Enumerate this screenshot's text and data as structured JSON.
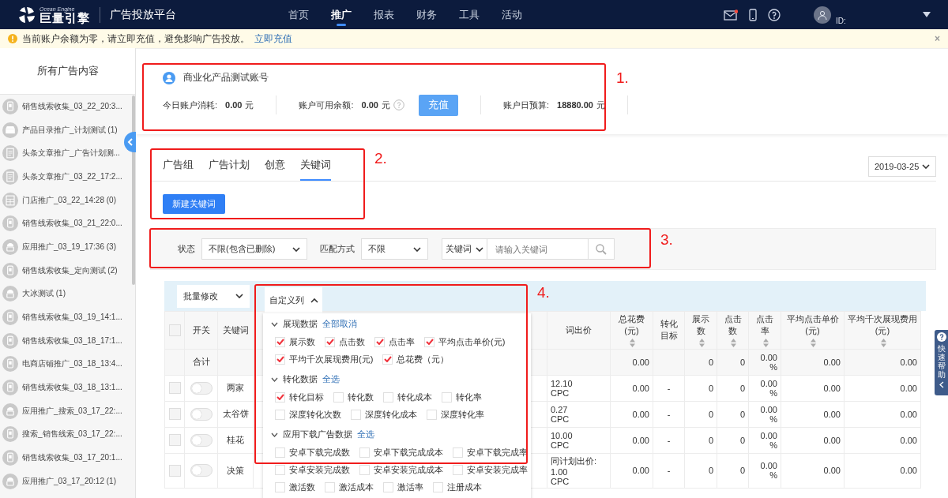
{
  "header": {
    "logo_sub": "Ocean Engine",
    "logo_text": "巨量引擎",
    "platform": "广告投放平台",
    "user_id_label": "ID:",
    "nav": [
      {
        "label": "首页",
        "selected": false
      },
      {
        "label": "推广",
        "selected": true
      },
      {
        "label": "报表",
        "selected": false
      },
      {
        "label": "财务",
        "selected": false
      },
      {
        "label": "工具",
        "selected": false
      },
      {
        "label": "活动",
        "selected": false
      }
    ]
  },
  "notice": {
    "text": "当前账户余额为零，请立即充值，避免影响广告投放。",
    "link": "立即充值",
    "close": "×"
  },
  "sidebar": {
    "title": "所有广告内容",
    "items": [
      {
        "label": "销售线索收集_03_22_20:3...",
        "kind": "phone"
      },
      {
        "label": "产品目录推广_计划测试 (1)",
        "kind": "shop"
      },
      {
        "label": "头条文章推广_广告计划测...",
        "kind": "doc"
      },
      {
        "label": "头条文章推广_03_22_17:2...",
        "kind": "doc"
      },
      {
        "label": "门店推广_03_22_14:28 (0)",
        "kind": "store"
      },
      {
        "label": "销售线索收集_03_21_22:0...",
        "kind": "phone"
      },
      {
        "label": "应用推广_03_19_17:36 (3)",
        "kind": "app"
      },
      {
        "label": "销售线索收集_定向测试 (2)",
        "kind": "phone"
      },
      {
        "label": "大冰测试 (1)",
        "kind": "app"
      },
      {
        "label": "销售线索收集_03_19_14:1...",
        "kind": "phone"
      },
      {
        "label": "销售线索收集_03_18_17:1...",
        "kind": "phone"
      },
      {
        "label": "电商店铺推广_03_18_13:4...",
        "kind": "phone"
      },
      {
        "label": "销售线索收集_03_18_13:1...",
        "kind": "phone"
      },
      {
        "label": "应用推广_搜索_03_17_22:...",
        "kind": "app"
      },
      {
        "label": "搜索_销售线索_03_17_22:...",
        "kind": "phone"
      },
      {
        "label": "销售线索收集_03_17_20:1...",
        "kind": "phone"
      },
      {
        "label": "应用推广_03_17_20:12 (1)",
        "kind": "app"
      }
    ]
  },
  "account": {
    "name": "商业化产品测试账号",
    "recharge": "充值",
    "stats": [
      {
        "label": "今日账户消耗:",
        "value": "0.00",
        "unit": "元",
        "help": false
      },
      {
        "label": "账户可用余额:",
        "value": "0.00",
        "unit": "元",
        "help": true
      },
      {
        "label": "账户日预算:",
        "value": "18880.00",
        "unit": "元",
        "help": false
      }
    ]
  },
  "tabs": [
    {
      "label": "广告组",
      "selected": false
    },
    {
      "label": "广告计划",
      "selected": false
    },
    {
      "label": "创意",
      "selected": false
    },
    {
      "label": "关键词",
      "selected": true
    }
  ],
  "new_button": "新建关键词",
  "date": "2019-03-25",
  "filters": {
    "status_label": "状态",
    "status_value": "不限(包含已删除)",
    "match_label": "匹配方式",
    "match_value": "不限",
    "search_scope": "关键词",
    "search_placeholder": "请输入关键词"
  },
  "toolbar": {
    "batch": "批量修改",
    "custom_columns": "自定义列",
    "custom_expanded": true
  },
  "table": {
    "select_all_checked": false,
    "columns": [
      {
        "label": "开关",
        "sortable": false
      },
      {
        "label": "关键词",
        "sortable": false
      },
      {
        "label": "词出价",
        "sortable": false
      },
      {
        "label": "总花费(元)",
        "sortable": true
      },
      {
        "label": "转化目标",
        "sortable": false
      },
      {
        "label": "展示数",
        "sortable": true
      },
      {
        "label": "点击数",
        "sortable": true
      },
      {
        "label": "点击率",
        "sortable": true
      },
      {
        "label": "平均点击单价(元)",
        "sortable": true
      },
      {
        "label": "平均千次展现费用(元)",
        "sortable": true
      }
    ],
    "total": {
      "checked": false,
      "cells": [
        "合计",
        null,
        null,
        "0.00",
        null,
        "0",
        "0",
        "0.00 %",
        "0.00",
        "0.00"
      ]
    },
    "rows": [
      {
        "checked": false,
        "on": false,
        "cells": [
          null,
          "两家",
          "12.10\nCPC",
          "0.00",
          "-",
          "0",
          "0",
          "0.00 %",
          "0.00",
          "0.00"
        ]
      },
      {
        "checked": false,
        "on": false,
        "cells": [
          null,
          "太谷饼",
          "0.27\nCPC",
          "0.00",
          "-",
          "0",
          "0",
          "0.00 %",
          "0.00",
          "0.00"
        ]
      },
      {
        "checked": false,
        "on": false,
        "cells": [
          null,
          "桂花",
          "10.00\nCPC",
          "0.00",
          "-",
          "0",
          "0",
          "0.00 %",
          "0.00",
          "0.00"
        ]
      },
      {
        "checked": false,
        "on": false,
        "cells": [
          null,
          "决策",
          "同计划出价:\n1.00\nCPC",
          "0.00",
          "-",
          "0",
          "0",
          "0.00 %",
          "0.00",
          "0.00"
        ]
      }
    ]
  },
  "column_picker": {
    "groups": [
      {
        "title": "展现数据",
        "action": "全部取消",
        "expanded": true,
        "options": [
          {
            "label": "展示数",
            "checked": true
          },
          {
            "label": "点击数",
            "checked": true
          },
          {
            "label": "点击率",
            "checked": true
          },
          {
            "label": "平均点击单价(元)",
            "checked": true
          },
          {
            "label": "平均千次展现费用(元)",
            "checked": true
          },
          {
            "label": "总花费（元）",
            "checked": true
          }
        ]
      },
      {
        "title": "转化数据",
        "action": "全选",
        "expanded": true,
        "options": [
          {
            "label": "转化目标",
            "checked": true
          },
          {
            "label": "转化数",
            "checked": false
          },
          {
            "label": "转化成本",
            "checked": false
          },
          {
            "label": "转化率",
            "checked": false
          },
          {
            "label": "深度转化次数",
            "checked": false
          },
          {
            "label": "深度转化成本",
            "checked": false
          },
          {
            "label": "深度转化率",
            "checked": false
          }
        ]
      },
      {
        "title": "应用下载广告数据",
        "action": "全选",
        "expanded": true,
        "options": [
          {
            "label": "安卓下载完成数",
            "checked": false
          },
          {
            "label": "安卓下载完成成本",
            "checked": false
          },
          {
            "label": "安卓下载完成率",
            "checked": false
          },
          {
            "label": "安卓安装完成数",
            "checked": false
          },
          {
            "label": "安卓安装完成成本",
            "checked": false
          },
          {
            "label": "安卓安装完成率",
            "checked": false
          },
          {
            "label": "激活数",
            "checked": false
          },
          {
            "label": "激活成本",
            "checked": false
          },
          {
            "label": "激活率",
            "checked": false
          },
          {
            "label": "注册成本",
            "checked": false
          }
        ]
      }
    ]
  },
  "help_tab": "快速帮助",
  "annotations": [
    "1.",
    "2.",
    "3.",
    "4."
  ]
}
